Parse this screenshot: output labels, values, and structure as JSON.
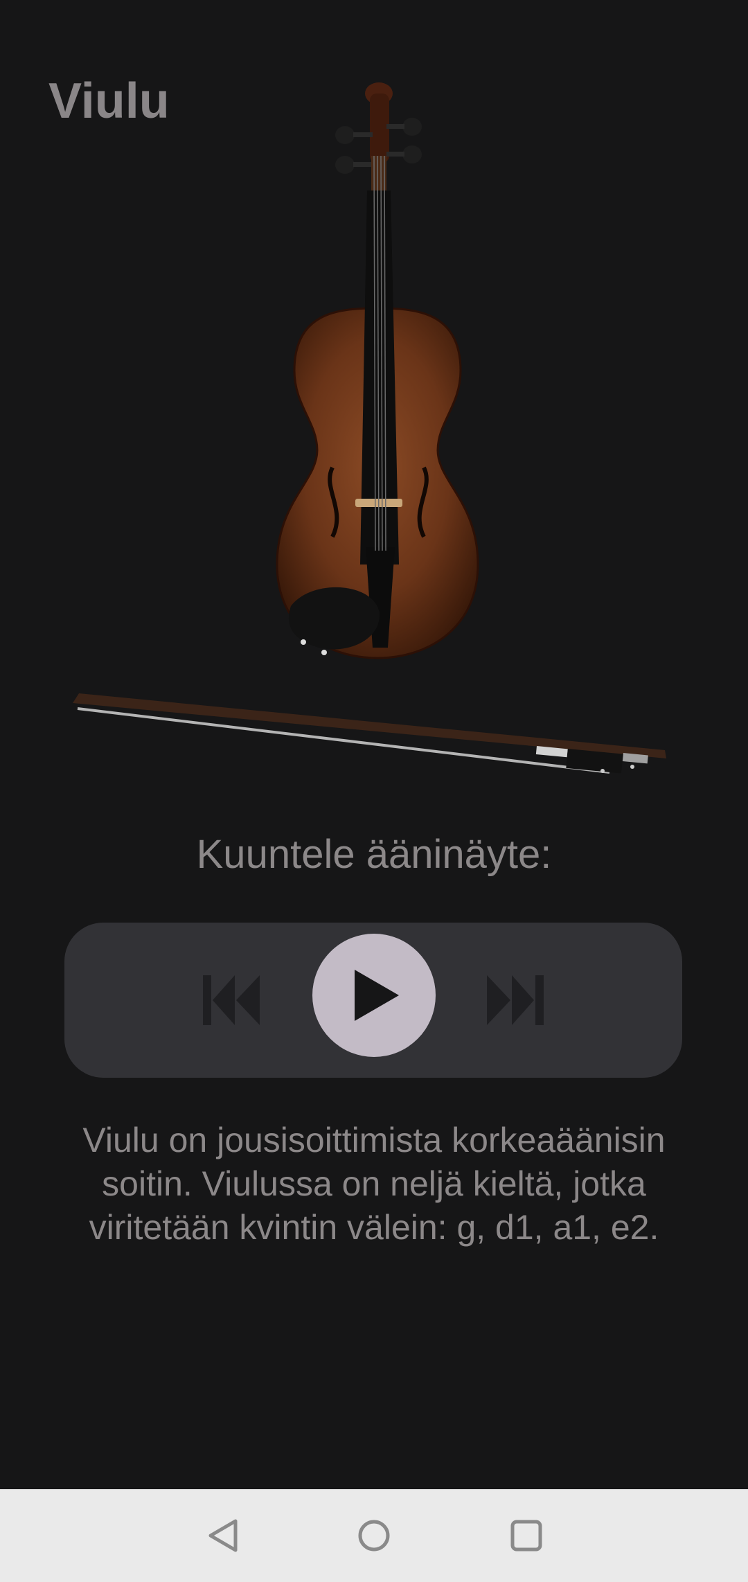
{
  "screen": {
    "title": "Viulu",
    "listen_label": "Kuuntele ääninäyte:",
    "description": "Viulu on jousisoittimista korkeaäänisin soitin. Viulussa on neljä kieltä, jotka viritetään kvintin välein: g, d1, a1, e2."
  },
  "images": {
    "violin": "violin-image",
    "bow": "bow-image"
  },
  "player": {
    "prev_icon": "skip-previous-icon",
    "play_icon": "play-icon",
    "next_icon": "skip-next-icon"
  },
  "nav": {
    "back_icon": "back-triangle-icon",
    "home_icon": "home-circle-icon",
    "recent_icon": "recents-square-icon"
  },
  "colors": {
    "background": "#161617",
    "player_background": "#323236",
    "play_button": "#c3bbc6",
    "text": "#8c8889",
    "nav_bar": "#eaeaea"
  }
}
